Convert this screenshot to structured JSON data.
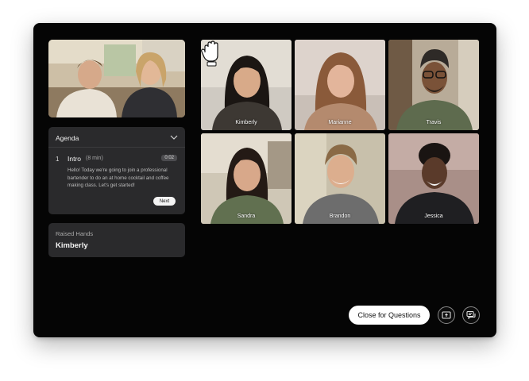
{
  "agenda": {
    "header": "Agenda",
    "item_number": "1",
    "item_title": "Intro",
    "item_duration": "(8 min)",
    "timer": "0:02",
    "description": "Hello! Today we're going to join a professional bartender to do an at home cocktail and coffee making class. Let's get started!",
    "next_label": "Next"
  },
  "raised_hands": {
    "label": "Raised Hands",
    "name": "Kimberly"
  },
  "participants": [
    "Kimberly",
    "Marianne",
    "Travis",
    "Sandra",
    "Brandon",
    "Jessica"
  ],
  "controls": {
    "close_label": "Close for Questions",
    "present_icon": "present-icon",
    "chat_icon": "chat-icon"
  }
}
